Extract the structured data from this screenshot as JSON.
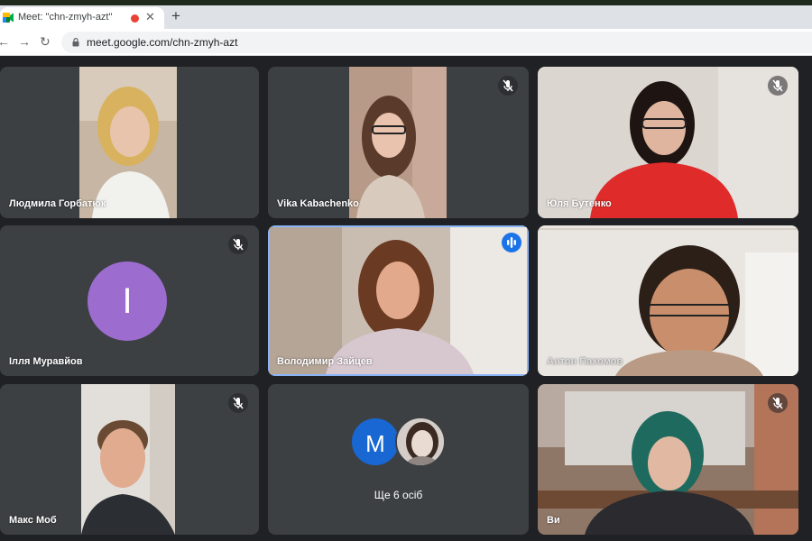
{
  "browser": {
    "tab_title": "Meet: \"chn-zmyh-azt\"",
    "tab_close": "✕",
    "new_tab": "+",
    "back": "←",
    "forward": "→",
    "reload": "↻",
    "url": "meet.google.com/chn-zmyh-azt"
  },
  "meet": {
    "participants": [
      {
        "name": "Людмила Горбатюк",
        "muted": false
      },
      {
        "name": "Vika Kabachenko",
        "muted": true
      },
      {
        "name": "Юля Бутенко",
        "muted": true
      },
      {
        "name": "Ілля Муравйов",
        "muted": true,
        "avatar_letter": "I"
      },
      {
        "name": "Володимир Зайцев",
        "muted": false,
        "speaking": true
      },
      {
        "name": "Антон Пахомов",
        "muted": false
      },
      {
        "name": "Макс Моб",
        "muted": true
      },
      {
        "name": "Ви",
        "muted": true
      }
    ],
    "others": {
      "avatar_letter": "M",
      "label": "Ще 6 осіб"
    }
  },
  "colors": {
    "speaking_accent": "#1a73e8",
    "active_outline": "#8ab4f8",
    "tile_bg": "#3c4043",
    "avatar_purple": "#9c6ccf",
    "avatar_blue": "#1967d2"
  }
}
